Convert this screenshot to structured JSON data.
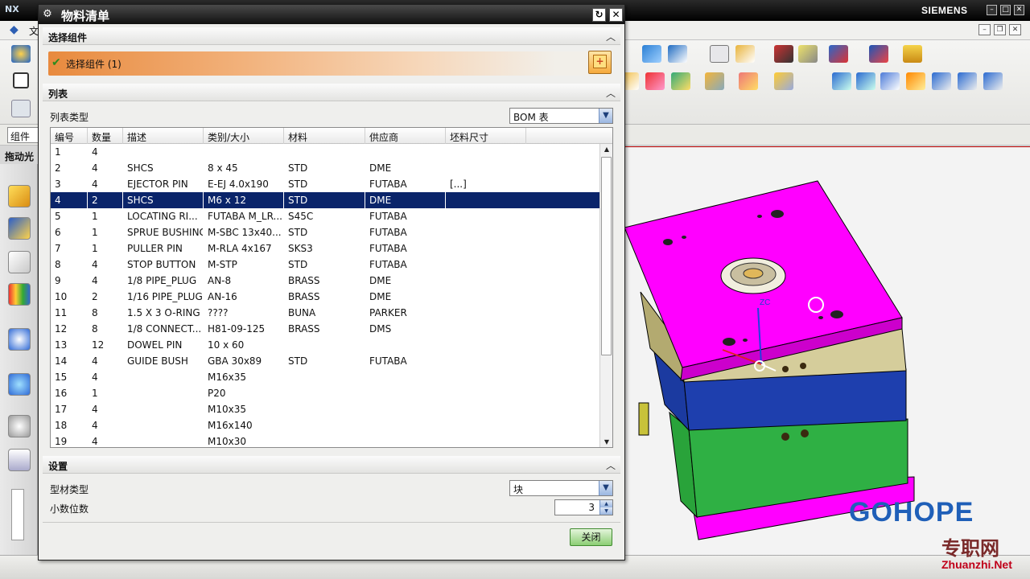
{
  "app": {
    "brand": "SIEMENS",
    "logo": "NX",
    "menu_first": "文",
    "filter_value": "组件",
    "left_panel_label": "拖动光"
  },
  "dialog": {
    "title": "物料清单",
    "section_select": {
      "title": "选择组件",
      "item_label": "选择组件 (1)"
    },
    "section_list": {
      "title": "列表",
      "list_type_label": "列表类型",
      "list_type_value": "BOM 表",
      "columns": [
        "编号",
        "数量",
        "描述",
        "类别/大小",
        "材料",
        "供应商",
        "坯料尺寸"
      ],
      "rows": [
        [
          "1",
          "4",
          "",
          "",
          "",
          "",
          ""
        ],
        [
          "2",
          "4",
          "SHCS",
          "8 x 45",
          "STD",
          "DME",
          ""
        ],
        [
          "3",
          "4",
          "EJECTOR PIN",
          "E-EJ 4.0x190",
          "STD",
          "FUTABA",
          "[...]"
        ],
        [
          "4",
          "2",
          "SHCS",
          "M6 x 12",
          "STD",
          "DME",
          ""
        ],
        [
          "5",
          "1",
          "LOCATING RI...",
          "FUTABA M_LR...",
          "S45C",
          "FUTABA",
          ""
        ],
        [
          "6",
          "1",
          "SPRUE BUSHING",
          "M-SBC 13x40...",
          "STD",
          "FUTABA",
          ""
        ],
        [
          "7",
          "1",
          "PULLER PIN",
          "M-RLA 4x167",
          "SKS3",
          "FUTABA",
          ""
        ],
        [
          "8",
          "4",
          "STOP BUTTON",
          "M-STP",
          "STD",
          "FUTABA",
          ""
        ],
        [
          "9",
          "4",
          "1/8 PIPE_PLUG",
          "AN-8",
          "BRASS",
          "DME",
          ""
        ],
        [
          "10",
          "2",
          "1/16 PIPE_PLUG",
          "AN-16",
          "BRASS",
          "DME",
          ""
        ],
        [
          "11",
          "8",
          "1.5 X 3 O-RING",
          "????",
          "BUNA",
          "PARKER",
          ""
        ],
        [
          "12",
          "8",
          "1/8 CONNECT...",
          "H81-09-125",
          "BRASS",
          "DMS",
          ""
        ],
        [
          "13",
          "12",
          "DOWEL PIN",
          "10 x 60",
          "",
          "",
          ""
        ],
        [
          "14",
          "4",
          "GUIDE BUSH",
          "GBA 30x89",
          "STD",
          "FUTABA",
          ""
        ],
        [
          "15",
          "4",
          "",
          "M16x35",
          "",
          "",
          ""
        ],
        [
          "16",
          "1",
          "",
          "P20",
          "",
          "",
          ""
        ],
        [
          "17",
          "4",
          "",
          "M10x35",
          "",
          "",
          ""
        ],
        [
          "18",
          "4",
          "",
          "M16x140",
          "",
          "",
          ""
        ],
        [
          "19",
          "4",
          "",
          "M10x30",
          "",
          "",
          ""
        ]
      ],
      "selected_row": 3
    },
    "section_settings": {
      "title": "设置",
      "material_type_label": "型材类型",
      "material_type_value": "块",
      "decimal_label": "小数位数",
      "decimal_value": "3"
    },
    "close_label": "关闭"
  },
  "watermark": {
    "brand": "GOHOPE",
    "site": "Zhuanzhi.Net",
    "cn": "专职网"
  },
  "viewport": {
    "axis_label": "ZC"
  },
  "colors": {
    "selection": "#0a246a",
    "select_bar_start": "#e88a3e",
    "mold_top": "#ff00ff",
    "mold_khaki": "#c8bf8c",
    "mold_blue": "#1b3aa0",
    "mold_green": "#2fb044"
  }
}
